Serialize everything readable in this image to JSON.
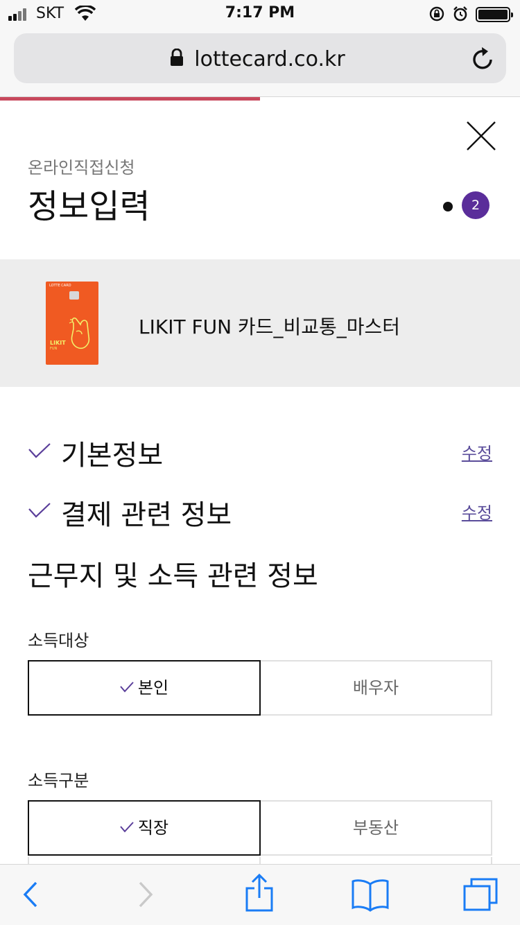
{
  "status_bar": {
    "carrier": "SKT",
    "time": "7:17 PM"
  },
  "browser": {
    "url": "lottecard.co.kr",
    "load_progress": 0.5,
    "progress_color": "#c8495d"
  },
  "header": {
    "subtitle": "온라인직접신청",
    "title": "정보입력",
    "step_number": "2",
    "step_color": "#5a2d9a"
  },
  "card": {
    "brand": "LOTTE CARD",
    "label": "LIKIT",
    "sub_label": "FUN",
    "name": "LIKIT FUN 카드_비교통_마스터",
    "color": "#f05a22"
  },
  "sections": {
    "basic": {
      "title": "기본정보",
      "edit_label": "수정"
    },
    "payment": {
      "title": "결제 관련 정보",
      "edit_label": "수정"
    },
    "current_title": "근무지 및 소득 관련 정보"
  },
  "income_target": {
    "label": "소득대상",
    "options": [
      "본인",
      "배우자"
    ],
    "selected": "본인"
  },
  "income_type": {
    "label": "소득구분",
    "options": [
      "직장",
      "부동산"
    ],
    "selected": "직장"
  },
  "colors": {
    "check": "#5a3e9a",
    "edit_link": "#5a4c9a",
    "ios_blue": "#1a7cf5"
  }
}
